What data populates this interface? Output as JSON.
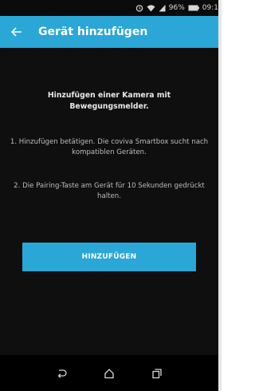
{
  "status_bar": {
    "battery_percent": "96%",
    "time": "09:1",
    "icons": [
      "alarm-icon",
      "wifi-icon",
      "signal-icon",
      "battery-icon"
    ]
  },
  "app_bar": {
    "back_icon": "arrow-left-icon",
    "title": "Gerät hinzufügen"
  },
  "content": {
    "heading": "Hinzufügen einer Kamera mit Bewegungsmelder.",
    "steps": [
      "1. Hinzufügen betätigen. Die coviva Smartbox sucht nach kompatiblen Geräten.",
      "2. Die Pairing-Taste am Gerät für 10 Sekunden gedrückt halten."
    ],
    "button_label": "HINZUFÜGEN"
  },
  "nav_bar": {
    "icons": [
      "back-icon",
      "home-icon",
      "recents-icon"
    ]
  },
  "colors": {
    "accent": "#2aa7d6",
    "background": "#0f0f0f",
    "status_bar": "#0b0b0b",
    "nav_bar": "#000000"
  }
}
